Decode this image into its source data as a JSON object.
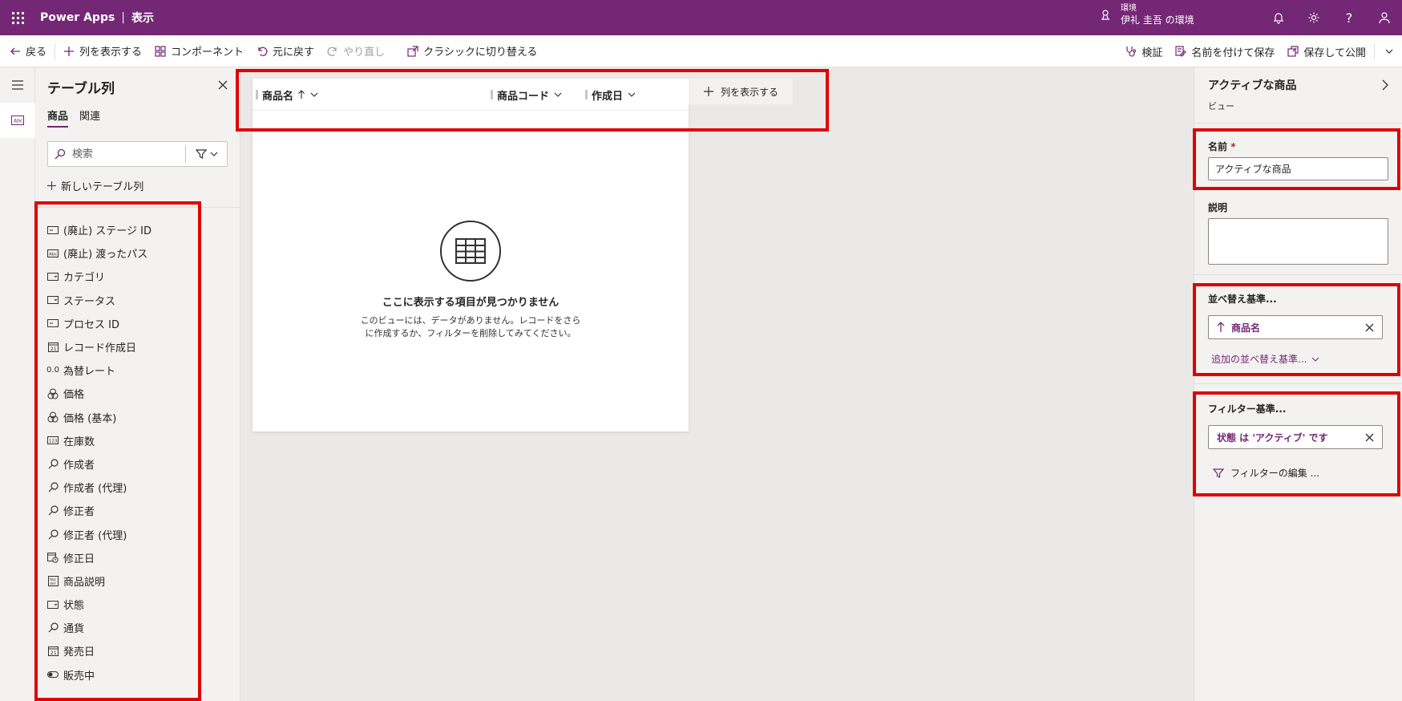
{
  "app": {
    "name": "Power Apps",
    "separator": "|",
    "page": "表示"
  },
  "environment": {
    "label": "環境",
    "name": "伊礼 圭吾 の環境"
  },
  "commandbar": {
    "back": "戻る",
    "show_columns": "列を表示する",
    "components": "コンポーネント",
    "undo": "元に戻す",
    "redo": "やり直し",
    "switch_classic": "クラシックに切り替える",
    "validate": "検証",
    "save_as": "名前を付けて保存",
    "save_publish": "保存して公開"
  },
  "column_panel": {
    "title": "テーブル列",
    "tabs": [
      {
        "label": "商品",
        "active": true
      },
      {
        "label": "関連",
        "active": false
      }
    ],
    "search_placeholder": "検索",
    "new_column": "新しいテーブル列",
    "fields": [
      {
        "icon": "text-field-icon",
        "label": "(廃止) ステージ ID"
      },
      {
        "icon": "abc-icon",
        "label": "(廃止) 渡ったパス"
      },
      {
        "icon": "choice-icon",
        "label": "カテゴリ"
      },
      {
        "icon": "choice-icon",
        "label": "ステータス"
      },
      {
        "icon": "text-field-icon",
        "label": "プロセス ID"
      },
      {
        "icon": "calendar-icon",
        "label": "レコード作成日"
      },
      {
        "icon": "decimal-icon",
        "label": "為替レート"
      },
      {
        "icon": "currency-icon",
        "label": "価格"
      },
      {
        "icon": "currency-icon",
        "label": "価格 (基本)"
      },
      {
        "icon": "number-icon",
        "label": "在庫数"
      },
      {
        "icon": "lookup-icon",
        "label": "作成者"
      },
      {
        "icon": "lookup-icon",
        "label": "作成者 (代理)"
      },
      {
        "icon": "lookup-icon",
        "label": "修正者"
      },
      {
        "icon": "lookup-icon",
        "label": "修正者 (代理)"
      },
      {
        "icon": "datetime-icon",
        "label": "修正日"
      },
      {
        "icon": "multiline-text-icon",
        "label": "商品説明"
      },
      {
        "icon": "choice-icon",
        "label": "状態"
      },
      {
        "icon": "lookup-icon",
        "label": "通貨"
      },
      {
        "icon": "calendar-icon",
        "label": "発売日"
      },
      {
        "icon": "toggle-icon",
        "label": "販売中"
      }
    ]
  },
  "grid": {
    "columns": [
      {
        "label": "商品名",
        "sorted": "asc"
      },
      {
        "label": "商品コード"
      },
      {
        "label": "作成日"
      }
    ],
    "show_columns": "列を表示する",
    "empty_title": "ここに表示する項目が見つかりません",
    "empty_desc_line1": "このビューには、データがありません。レコードをさら",
    "empty_desc_line2": "に作成するか、フィルターを削除してみてください。"
  },
  "view_panel": {
    "title": "アクティブな商品",
    "subtitle": "ビュー",
    "name_label": "名前",
    "required_mark": "*",
    "name_value": "アクティブな商品",
    "description_label": "説明",
    "description_value": "",
    "sort_label": "並べ替え基準...",
    "sort_item": "商品名",
    "add_sort": "追加の並べ替え基準...",
    "filter_label": "フィルター基準...",
    "filter_item": "状態 は 'アクティブ' です",
    "edit_filters": "フィルターの編集 ..."
  },
  "colors": {
    "brand": "#742774",
    "highlight": "#e00000"
  }
}
